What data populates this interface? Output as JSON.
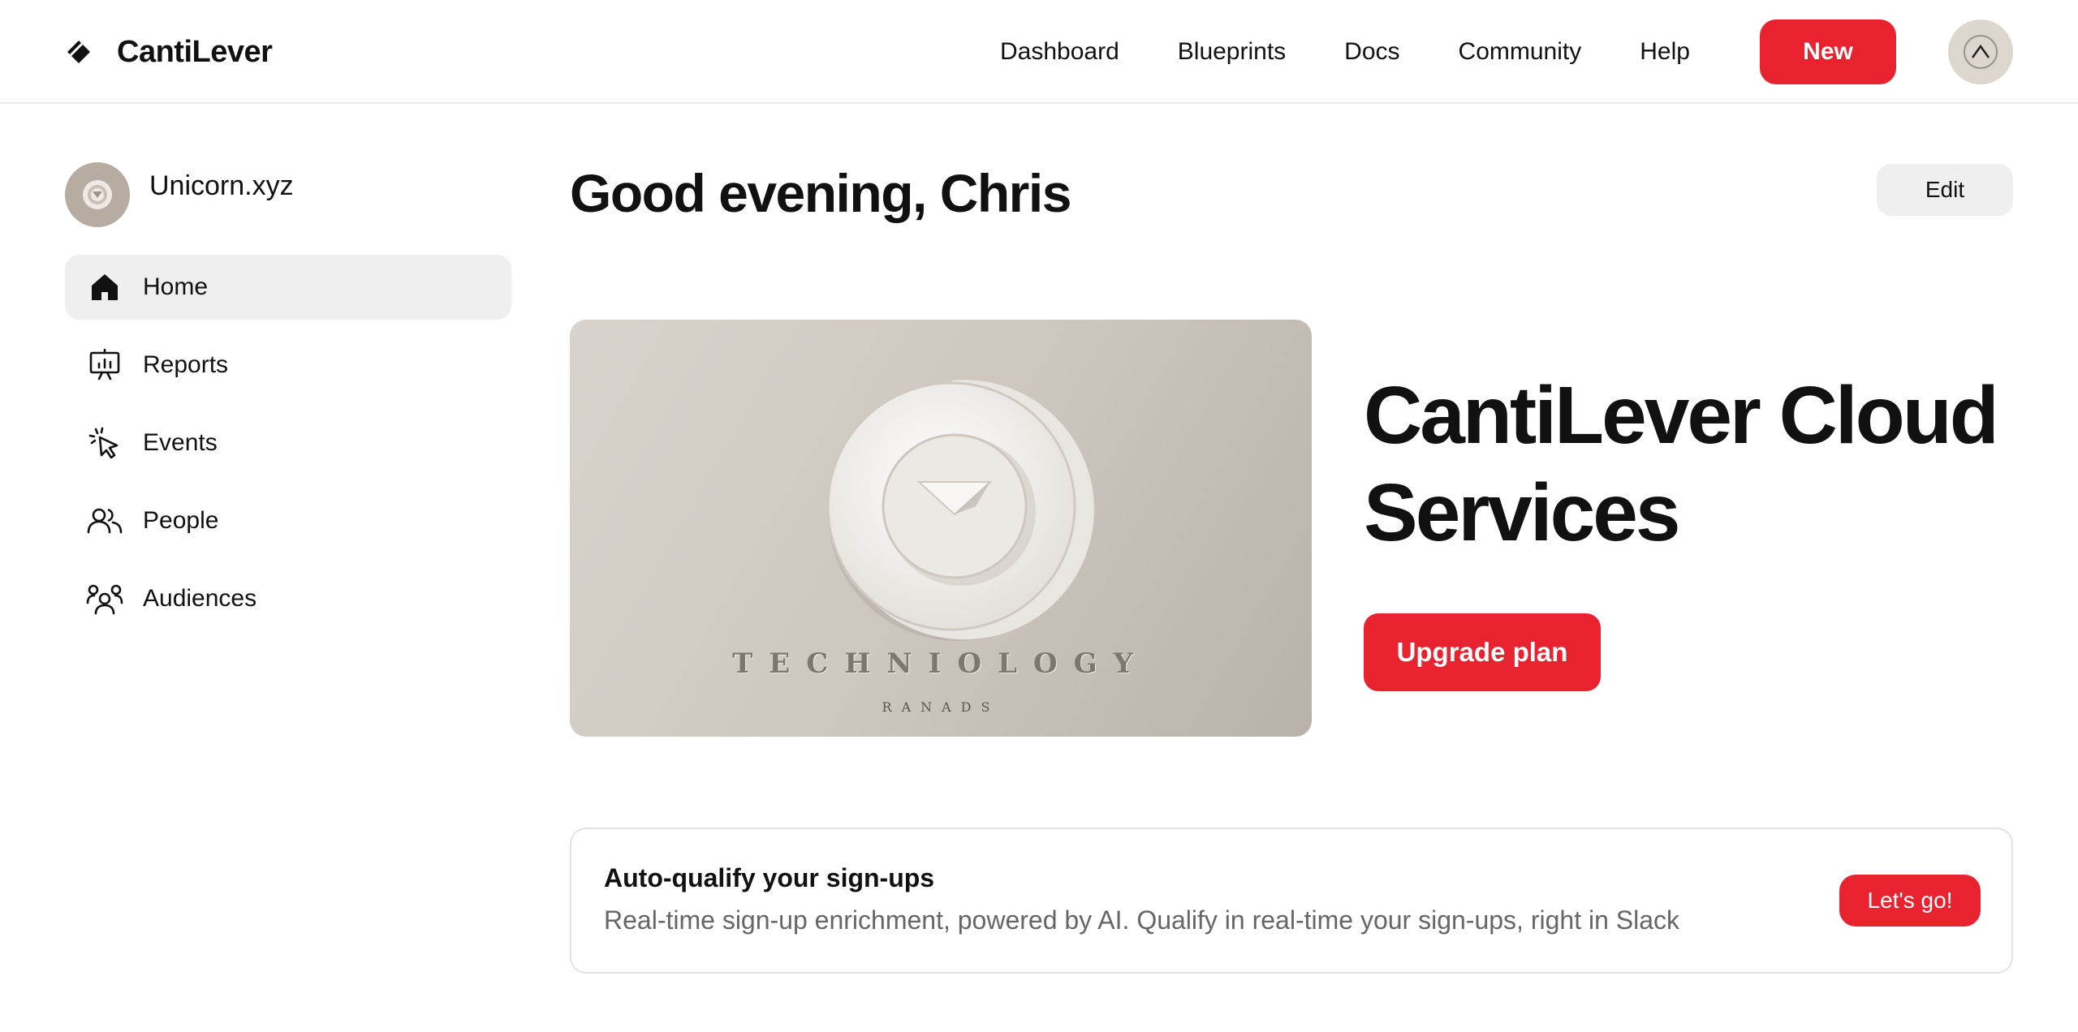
{
  "app": {
    "name": "CantiLever"
  },
  "nav": {
    "links": [
      "Dashboard",
      "Blueprints",
      "Docs",
      "Community",
      "Help"
    ],
    "new_label": "New"
  },
  "workspace": {
    "name": "Unicorn.xyz"
  },
  "sidebar": {
    "items": [
      {
        "label": "Home",
        "icon": "home-icon",
        "active": true
      },
      {
        "label": "Reports",
        "icon": "presentation-chart-icon",
        "active": false
      },
      {
        "label": "Events",
        "icon": "cursor-click-icon",
        "active": false
      },
      {
        "label": "People",
        "icon": "users-icon",
        "active": false
      },
      {
        "label": "Audiences",
        "icon": "audience-group-icon",
        "active": false
      }
    ]
  },
  "main": {
    "greeting": "Good evening, Chris",
    "edit_label": "Edit",
    "hero": {
      "image_text": "TECHNIOLOGY",
      "image_subtext": "RANADS",
      "title": "CantiLever Cloud Services",
      "cta_label": "Upgrade plan"
    },
    "promo": {
      "title": "Auto-qualify your sign-ups",
      "text": "Real-time sign-up enrichment, powered by AI. Qualify in real-time your sign-ups, right in Slack",
      "cta_label": "Let's go!"
    }
  },
  "colors": {
    "accent": "#e8222f",
    "active_bg": "#efefef"
  }
}
